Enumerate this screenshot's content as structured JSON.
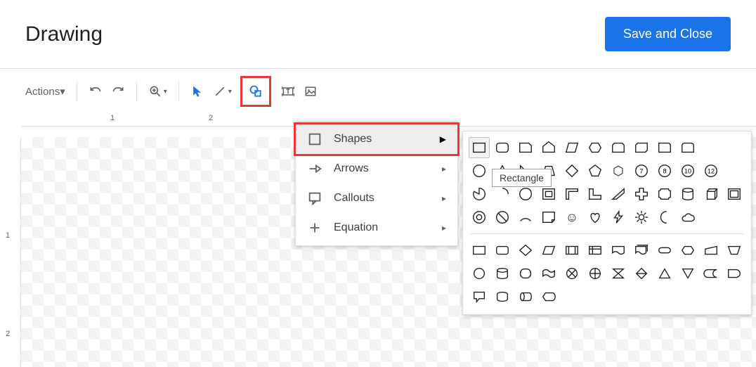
{
  "header": {
    "title": "Drawing",
    "save_label": "Save and Close"
  },
  "toolbar": {
    "actions_label": "Actions"
  },
  "ruler": {
    "labels": [
      "1",
      "2"
    ]
  },
  "vruler": {
    "labels": [
      "1",
      "2"
    ]
  },
  "menu": {
    "items": [
      {
        "label": "Shapes"
      },
      {
        "label": "Arrows"
      },
      {
        "label": "Callouts"
      },
      {
        "label": "Equation"
      }
    ]
  },
  "tooltip": "Rectangle",
  "palette": {
    "section1_names": [
      "rectangle",
      "rounded-rectangle",
      "snip-corner",
      "pentagon-up",
      "parallelogram-r",
      "hexagon-h",
      "snip-double",
      "snip-diagonal",
      "round-single",
      "round-double",
      "circle",
      "triangle",
      "right-triangle",
      "trapezoid",
      "diamond",
      "pentagon",
      "hexagon",
      "heptagon",
      "octagon",
      "decagon",
      "dodecagon",
      "pie",
      "partial-circle",
      "teardrop",
      "frame",
      "half-frame",
      "l-shape",
      "diagonal-stripe",
      "cross",
      "plaque",
      "can",
      "cube",
      "bevel",
      "donut",
      "no-symbol",
      "arc",
      "folded-corner",
      "smiley",
      "heart",
      "lightning",
      "sun",
      "moon",
      "cloud"
    ],
    "section1_glyphs": [
      "",
      "",
      "",
      "",
      "",
      "",
      "",
      "",
      "",
      "",
      "",
      "",
      "",
      "",
      "",
      "",
      "⬡",
      "7",
      "8",
      "10",
      "12",
      "",
      "",
      "",
      "",
      "",
      "",
      "",
      "",
      "",
      "",
      "",
      "",
      "",
      "",
      "",
      "",
      "☺",
      "",
      "",
      "",
      "",
      ""
    ],
    "section2_names": [
      "flow-rect",
      "flow-roundrect",
      "flow-diamond",
      "flow-parallelogram",
      "flow-predefined",
      "flow-internal",
      "flow-document",
      "flow-multidoc",
      "flow-terminator",
      "flow-preparation",
      "flow-manual-input",
      "flow-manual-op",
      "flow-circle",
      "flow-drum",
      "flow-squircle",
      "flow-wave",
      "flow-summing",
      "flow-or",
      "flow-collate",
      "flow-sort",
      "flow-extract",
      "flow-merge",
      "flow-stored",
      "flow-delay",
      "flow-callout",
      "flow-magnetic",
      "flow-direct",
      "flow-display"
    ]
  }
}
